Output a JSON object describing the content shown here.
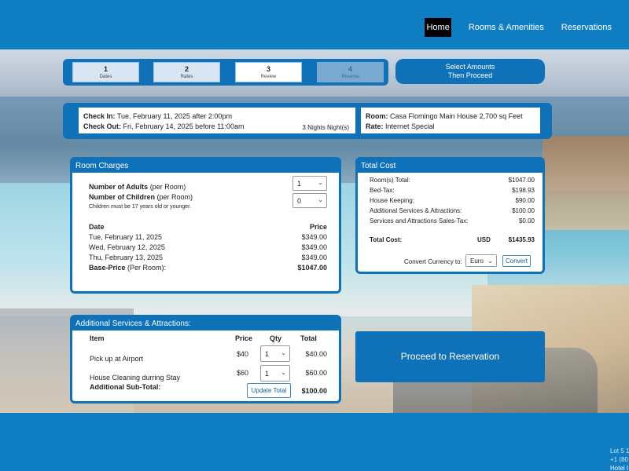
{
  "nav": {
    "items": [
      {
        "label": "Home",
        "active": true
      },
      {
        "label": "Rooms & Amenities",
        "active": false
      },
      {
        "label": "Reservations",
        "active": false
      }
    ]
  },
  "steps": [
    {
      "number": "1",
      "label": "Dates",
      "state": "done"
    },
    {
      "number": "2",
      "label": "Rates",
      "state": "done"
    },
    {
      "number": "3",
      "label": "Review",
      "state": "current"
    },
    {
      "number": "4",
      "label": "Reserve",
      "state": "disabled"
    }
  ],
  "select_hint": {
    "line1": "Select Amounts",
    "line2": "Then Proceed"
  },
  "stay": {
    "check_in_label": "Check In:",
    "check_in_value": "Tue, February 11, 2025 after 2:00pm",
    "check_out_label": "Check Out:",
    "check_out_value": "Fri, February 14, 2025 before 11:00am",
    "nights": "3 Nights Night(s)",
    "room_label": "Room:",
    "room_value": "Casa Flomingo Main House 2,700 sq Feet",
    "rate_label": "Rate:",
    "rate_value": "Internet Special"
  },
  "room_charges": {
    "title": "Room Charges",
    "adults_label": "Number of Adults",
    "adults_suffix": "(per Room)",
    "adults_value": "1",
    "children_label": "Number of Children",
    "children_suffix": "(per Room)",
    "children_value": "0",
    "children_note": "Children must be 17 years old or younger.",
    "date_header": "Date",
    "price_header": "Price",
    "rows": [
      {
        "date": "Tue, February 11, 2025",
        "price": "$349.00"
      },
      {
        "date": "Wed, February 12, 2025",
        "price": "$349.00"
      },
      {
        "date": "Thu, February 13, 2025",
        "price": "$349.00"
      }
    ],
    "base_label": "Base-Price",
    "base_suffix": "(Per Room):",
    "base_value": "$1047.00"
  },
  "total_cost": {
    "title": "Total Cost",
    "rows": [
      {
        "label": "Room(s) Total:",
        "value": "$1047.00"
      },
      {
        "label": "Bed-Tax:",
        "value": "$198.93"
      },
      {
        "label": "House Keeping:",
        "value": "$90.00"
      },
      {
        "label": "Additional Services & Attractions:",
        "value": "$100.00"
      },
      {
        "label": "Services and Attractions Sales-Tax:",
        "value": "$0.00"
      }
    ],
    "total_label": "Total Cost:",
    "currency_code": "USD",
    "total_value": "$1435.93",
    "convert_label": "Convert Currency to:",
    "convert_value": "Euro",
    "convert_button": "Convert"
  },
  "services": {
    "title": "Additional Services & Attractions:",
    "item_header": "Item",
    "price_header": "Price",
    "qty_header": "Qty",
    "total_header": "Total",
    "rows": [
      {
        "item": "Pick up at Airport",
        "price": "$40",
        "qty": "1",
        "total": "$40.00"
      },
      {
        "item": "House Cleaning durring Stay",
        "price": "$60",
        "qty": "1",
        "total": "$60.00"
      }
    ],
    "subtotal_label": "Additional Sub-Total:",
    "update_button": "Update Total",
    "subtotal_value": "$100.00"
  },
  "proceed_button": "Proceed to Reservation",
  "footer": {
    "line1": "Lot 5 1",
    "line2": "+1 (80",
    "line3": "Hotel I"
  }
}
